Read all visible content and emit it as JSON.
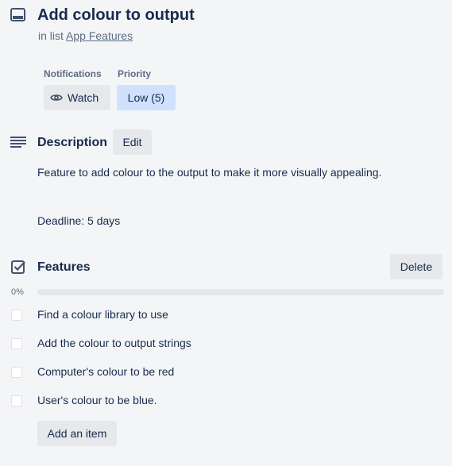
{
  "card": {
    "title": "Add colour to output",
    "in_list_prefix": "in list",
    "list_name": "App Features",
    "icon": "card-icon"
  },
  "notifications": {
    "heading": "Notifications",
    "watch_label": "Watch",
    "icon": "eye-icon"
  },
  "priority": {
    "heading": "Priority",
    "value_label": "Low (5)",
    "color": "#cfe1fd"
  },
  "description": {
    "title": "Description",
    "edit_label": "Edit",
    "icon": "description-lines-icon",
    "paragraphs": [
      "Feature to add colour to the output to make it more visually appealing.",
      "Deadline: 5 days"
    ]
  },
  "checklist": {
    "title": "Features",
    "delete_label": "Delete",
    "icon": "checkbox-checked-icon",
    "progress_percent": 0,
    "progress_label": "0%",
    "items": [
      {
        "label": "Find a colour library to use",
        "checked": false
      },
      {
        "label": "Add the colour to output strings",
        "checked": false
      },
      {
        "label": "Computer's colour to be red",
        "checked": false
      },
      {
        "label": "User's colour to be blue.",
        "checked": false
      }
    ],
    "add_item_label": "Add an item"
  },
  "colors": {
    "text": "#172b4d",
    "muted": "#5e6c84",
    "button_gray": "#e6e8eb",
    "background": "#f4f5f7"
  }
}
